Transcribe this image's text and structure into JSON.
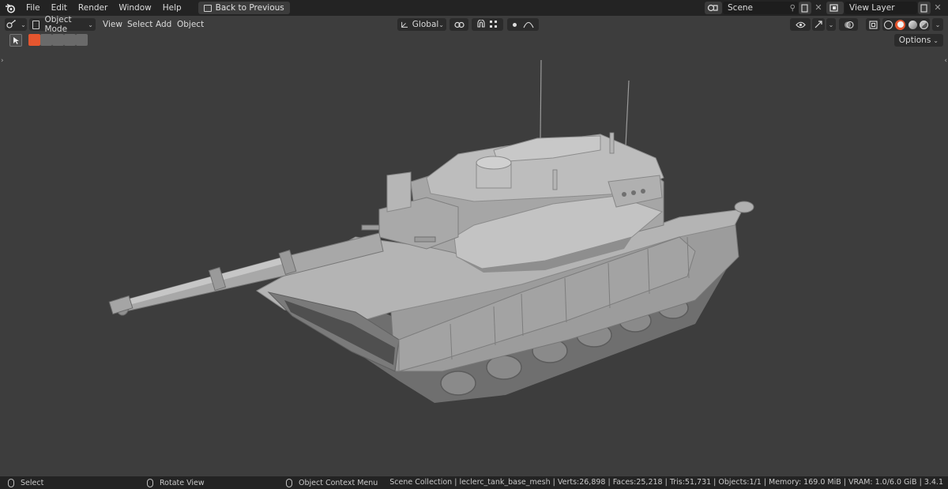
{
  "topbar": {
    "menu": [
      "File",
      "Edit",
      "Render",
      "Window",
      "Help"
    ],
    "back_label": "Back to Previous",
    "scene": "Scene",
    "view_layer": "View Layer"
  },
  "header": {
    "mode": "Object Mode",
    "menus": [
      "View",
      "Select",
      "Add",
      "Object"
    ],
    "orientation": "Global",
    "options": "Options"
  },
  "status": {
    "select": "Select",
    "rotate": "Rotate View",
    "context": "Object Context Menu",
    "info": "Scene Collection | leclerc_tank_base_mesh | Verts:26,898 | Faces:25,218 | Tris:51,731 | Objects:1/1 | Memory: 169.0 MiB | VRAM: 1.0/6.0 GiB | 3.4.1"
  },
  "colors": {
    "background": "#3d3d3d",
    "bar": "#232323",
    "accent": "#e5562f",
    "model": "#a8a8a8"
  }
}
